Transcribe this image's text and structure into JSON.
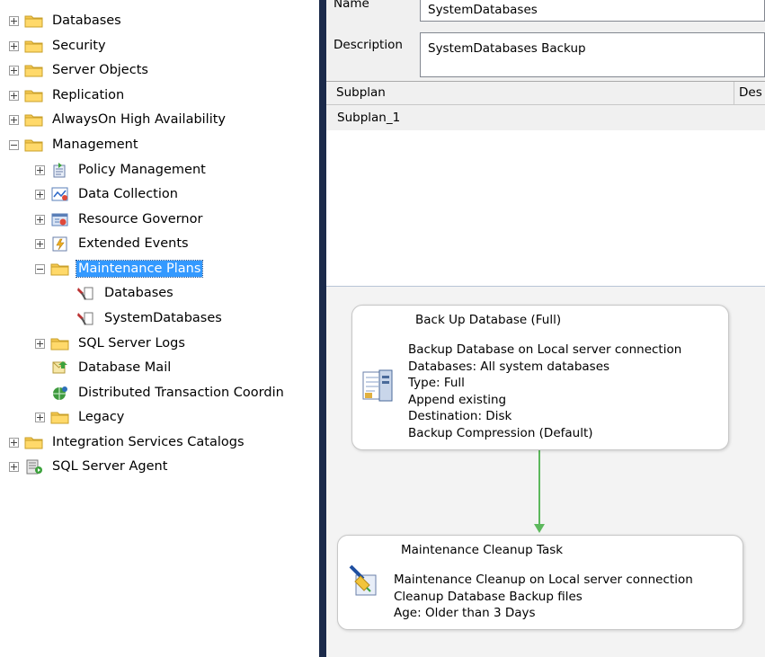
{
  "tree": {
    "items": [
      {
        "label": "Databases",
        "icon": "folder-icon",
        "expander": "plus"
      },
      {
        "label": "Security",
        "icon": "folder-icon",
        "expander": "plus"
      },
      {
        "label": "Server Objects",
        "icon": "folder-icon",
        "expander": "plus"
      },
      {
        "label": "Replication",
        "icon": "folder-icon",
        "expander": "plus"
      },
      {
        "label": "AlwaysOn High Availability",
        "icon": "folder-icon",
        "expander": "plus"
      },
      {
        "label": "Management",
        "icon": "folder-icon",
        "expander": "minus"
      },
      {
        "label": "Policy Management",
        "icon": "policy-icon",
        "expander": "plus"
      },
      {
        "label": "Data Collection",
        "icon": "data-collection-icon",
        "expander": "plus"
      },
      {
        "label": "Resource Governor",
        "icon": "resource-governor-icon",
        "expander": "plus"
      },
      {
        "label": "Extended Events",
        "icon": "extended-events-icon",
        "expander": "plus"
      },
      {
        "label": "Maintenance Plans",
        "icon": "folder-icon",
        "expander": "minus",
        "selected": true
      },
      {
        "label": "Databases",
        "icon": "maintenance-plan-icon",
        "expander": "none"
      },
      {
        "label": "SystemDatabases",
        "icon": "maintenance-plan-icon",
        "expander": "none"
      },
      {
        "label": "SQL Server Logs",
        "icon": "folder-icon",
        "expander": "plus"
      },
      {
        "label": "Database Mail",
        "icon": "database-mail-icon",
        "expander": "none"
      },
      {
        "label": "Distributed Transaction Coordin",
        "icon": "dtc-icon",
        "expander": "none"
      },
      {
        "label": "Legacy",
        "icon": "folder-icon",
        "expander": "plus"
      },
      {
        "label": "Integration Services Catalogs",
        "icon": "folder-icon",
        "expander": "plus"
      },
      {
        "label": "SQL Server Agent",
        "icon": "sql-agent-icon",
        "expander": "plus"
      }
    ]
  },
  "properties": {
    "name_label": "Name",
    "name_value": "SystemDatabases",
    "description_label": "Description",
    "description_value": "SystemDatabases Backup"
  },
  "subplans": {
    "col_subplan": "Subplan",
    "col_description": "Des",
    "rows": [
      "Subplan_1"
    ]
  },
  "designer": {
    "backup_task": {
      "title": "Back Up Database (Full)",
      "lines": [
        "Backup Database on Local server connection",
        "Databases: All system databases",
        "Type: Full",
        "Append existing",
        "Destination: Disk",
        "Backup Compression (Default)"
      ]
    },
    "cleanup_task": {
      "title": "Maintenance Cleanup Task",
      "lines": [
        "Maintenance Cleanup on Local server connection",
        "Cleanup Database Backup files",
        "Age: Older than 3 Days"
      ]
    },
    "connector_color": "#5cb85c"
  },
  "colors": {
    "selection": "#3399ff",
    "divider": "#1b2a4a",
    "folder": "#f5c850"
  }
}
